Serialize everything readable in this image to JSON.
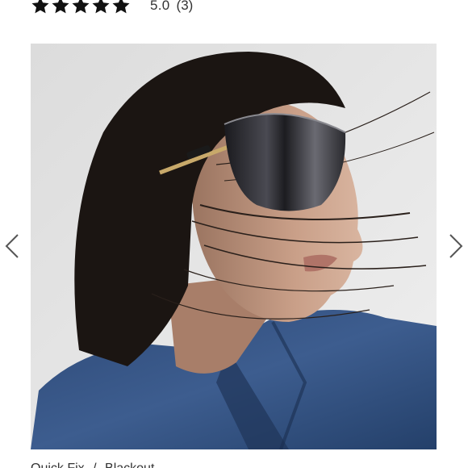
{
  "rating": {
    "stars": 5,
    "max_stars": 5,
    "value": "5.0",
    "count": "(3)"
  },
  "gallery": {
    "image_icon": "model-wearing-sunglasses-photo",
    "prev_icon": "chevron-left-icon",
    "next_icon": "chevron-right-icon"
  },
  "product": {
    "brand": "Quick Fix",
    "separator": "/",
    "name": "Blackout"
  },
  "colors": {
    "star": "#111111",
    "text": "#333333",
    "arrow": "#555555"
  }
}
